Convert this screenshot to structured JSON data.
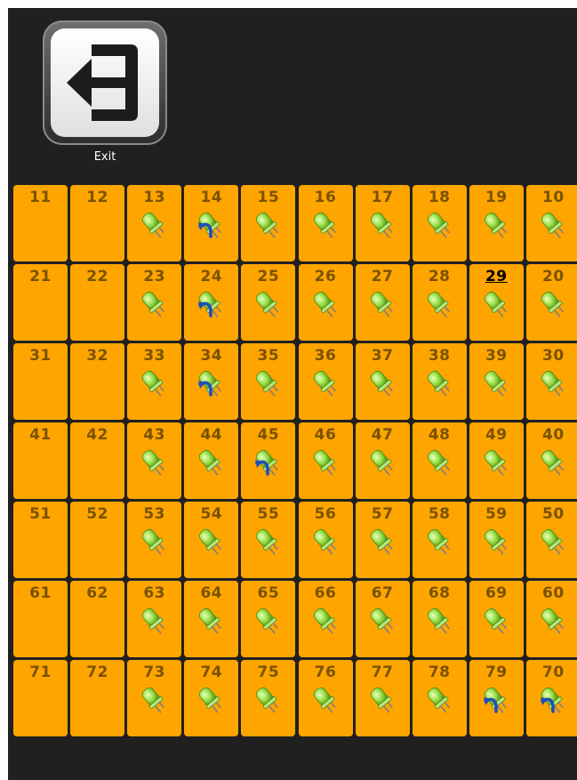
{
  "exit": {
    "label": "Exit"
  },
  "grid": {
    "rows": [
      {
        "cells": [
          {
            "label": "11",
            "led": false,
            "blue": false,
            "active": false
          },
          {
            "label": "12",
            "led": false,
            "blue": false,
            "active": false
          },
          {
            "label": "13",
            "led": true,
            "blue": false,
            "active": false
          },
          {
            "label": "14",
            "led": true,
            "blue": true,
            "active": false
          },
          {
            "label": "15",
            "led": true,
            "blue": false,
            "active": false
          },
          {
            "label": "16",
            "led": true,
            "blue": false,
            "active": false
          },
          {
            "label": "17",
            "led": true,
            "blue": false,
            "active": false
          },
          {
            "label": "18",
            "led": true,
            "blue": false,
            "active": false
          },
          {
            "label": "19",
            "led": true,
            "blue": false,
            "active": false
          },
          {
            "label": "10",
            "led": true,
            "blue": false,
            "active": false
          }
        ]
      },
      {
        "cells": [
          {
            "label": "21",
            "led": false,
            "blue": false,
            "active": false
          },
          {
            "label": "22",
            "led": false,
            "blue": false,
            "active": false
          },
          {
            "label": "23",
            "led": true,
            "blue": false,
            "active": false
          },
          {
            "label": "24",
            "led": true,
            "blue": true,
            "active": false
          },
          {
            "label": "25",
            "led": true,
            "blue": false,
            "active": false
          },
          {
            "label": "26",
            "led": true,
            "blue": false,
            "active": false
          },
          {
            "label": "27",
            "led": true,
            "blue": false,
            "active": false
          },
          {
            "label": "28",
            "led": true,
            "blue": false,
            "active": false
          },
          {
            "label": "29",
            "led": true,
            "blue": false,
            "active": true
          },
          {
            "label": "20",
            "led": true,
            "blue": false,
            "active": false
          }
        ]
      },
      {
        "cells": [
          {
            "label": "31",
            "led": false,
            "blue": false,
            "active": false
          },
          {
            "label": "32",
            "led": false,
            "blue": false,
            "active": false
          },
          {
            "label": "33",
            "led": true,
            "blue": false,
            "active": false
          },
          {
            "label": "34",
            "led": true,
            "blue": true,
            "active": false
          },
          {
            "label": "35",
            "led": true,
            "blue": false,
            "active": false
          },
          {
            "label": "36",
            "led": true,
            "blue": false,
            "active": false
          },
          {
            "label": "37",
            "led": true,
            "blue": false,
            "active": false
          },
          {
            "label": "38",
            "led": true,
            "blue": false,
            "active": false
          },
          {
            "label": "39",
            "led": true,
            "blue": false,
            "active": false
          },
          {
            "label": "30",
            "led": true,
            "blue": false,
            "active": false
          }
        ]
      },
      {
        "cells": [
          {
            "label": "41",
            "led": false,
            "blue": false,
            "active": false
          },
          {
            "label": "42",
            "led": false,
            "blue": false,
            "active": false
          },
          {
            "label": "43",
            "led": true,
            "blue": false,
            "active": false
          },
          {
            "label": "44",
            "led": true,
            "blue": false,
            "active": false
          },
          {
            "label": "45",
            "led": true,
            "blue": true,
            "active": false
          },
          {
            "label": "46",
            "led": true,
            "blue": false,
            "active": false
          },
          {
            "label": "47",
            "led": true,
            "blue": false,
            "active": false
          },
          {
            "label": "48",
            "led": true,
            "blue": false,
            "active": false
          },
          {
            "label": "49",
            "led": true,
            "blue": false,
            "active": false
          },
          {
            "label": "40",
            "led": true,
            "blue": false,
            "active": false
          }
        ]
      },
      {
        "cells": [
          {
            "label": "51",
            "led": false,
            "blue": false,
            "active": false
          },
          {
            "label": "52",
            "led": false,
            "blue": false,
            "active": false
          },
          {
            "label": "53",
            "led": true,
            "blue": false,
            "active": false
          },
          {
            "label": "54",
            "led": true,
            "blue": false,
            "active": false
          },
          {
            "label": "55",
            "led": true,
            "blue": false,
            "active": false
          },
          {
            "label": "56",
            "led": true,
            "blue": false,
            "active": false
          },
          {
            "label": "57",
            "led": true,
            "blue": false,
            "active": false
          },
          {
            "label": "58",
            "led": true,
            "blue": false,
            "active": false
          },
          {
            "label": "59",
            "led": true,
            "blue": false,
            "active": false
          },
          {
            "label": "50",
            "led": true,
            "blue": false,
            "active": false
          }
        ]
      },
      {
        "cells": [
          {
            "label": "61",
            "led": false,
            "blue": false,
            "active": false
          },
          {
            "label": "62",
            "led": false,
            "blue": false,
            "active": false
          },
          {
            "label": "63",
            "led": true,
            "blue": false,
            "active": false
          },
          {
            "label": "64",
            "led": true,
            "blue": false,
            "active": false
          },
          {
            "label": "65",
            "led": true,
            "blue": false,
            "active": false
          },
          {
            "label": "66",
            "led": true,
            "blue": false,
            "active": false
          },
          {
            "label": "67",
            "led": true,
            "blue": false,
            "active": false
          },
          {
            "label": "68",
            "led": true,
            "blue": false,
            "active": false
          },
          {
            "label": "69",
            "led": true,
            "blue": false,
            "active": false
          },
          {
            "label": "60",
            "led": true,
            "blue": false,
            "active": false
          }
        ]
      },
      {
        "cells": [
          {
            "label": "71",
            "led": false,
            "blue": false,
            "active": false
          },
          {
            "label": "72",
            "led": false,
            "blue": false,
            "active": false
          },
          {
            "label": "73",
            "led": true,
            "blue": false,
            "active": false
          },
          {
            "label": "74",
            "led": true,
            "blue": false,
            "active": false
          },
          {
            "label": "75",
            "led": true,
            "blue": false,
            "active": false
          },
          {
            "label": "76",
            "led": true,
            "blue": false,
            "active": false
          },
          {
            "label": "77",
            "led": true,
            "blue": false,
            "active": false
          },
          {
            "label": "78",
            "led": true,
            "blue": false,
            "active": false
          },
          {
            "label": "79",
            "led": true,
            "blue": true,
            "active": false
          },
          {
            "label": "70",
            "led": true,
            "blue": true,
            "active": false
          }
        ]
      }
    ]
  },
  "colors": {
    "background": "#202020",
    "cell": "#ffa500",
    "cell_text": "#7a5200",
    "active_text": "#000000",
    "led_green": "#9be04a",
    "arrow_blue": "#1e4fb8"
  },
  "icons": {
    "exit": "exit-door-arrow-icon",
    "led": "green-led-icon",
    "arrow": "blue-curved-arrow-icon"
  }
}
